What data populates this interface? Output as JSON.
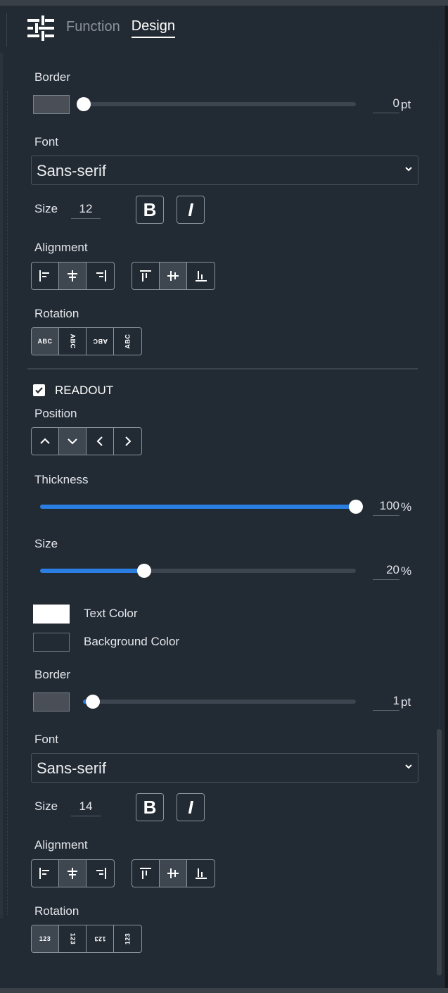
{
  "tabs": {
    "function": "Function",
    "design": "Design"
  },
  "border1": {
    "label": "Border",
    "value": 0,
    "unit": "pt",
    "slider_fraction": 0.0,
    "swatch_color": "#4a4f57"
  },
  "font1": {
    "label": "Font",
    "value": "Sans-serif",
    "size_label": "Size",
    "size_value": "12",
    "bold": "B",
    "italic": "I"
  },
  "align1": {
    "label": "Alignment"
  },
  "rotation1": {
    "label": "Rotation",
    "options": [
      "ABC",
      "ABC",
      "ABC",
      "ABC"
    ]
  },
  "readout": {
    "label": "READOUT",
    "checked": true
  },
  "position": {
    "label": "Position"
  },
  "thickness": {
    "label": "Thickness",
    "value": "100",
    "unit": "%",
    "slider_fraction": 1.0
  },
  "size_slider": {
    "label": "Size",
    "value": "20",
    "unit": "%",
    "slider_fraction": 0.33
  },
  "text_color": {
    "label": "Text Color",
    "color": "#ffffff"
  },
  "bg_color": {
    "label": "Background Color",
    "color": "#222a33"
  },
  "border2": {
    "label": "Border",
    "value": 1,
    "unit": "pt",
    "slider_fraction": 0.03,
    "swatch_color": "#4a4f57"
  },
  "font2": {
    "label": "Font",
    "value": "Sans-serif",
    "size_label": "Size",
    "size_value": "14",
    "bold": "B",
    "italic": "I"
  },
  "align2": {
    "label": "Alignment"
  },
  "rotation2": {
    "label": "Rotation",
    "options": [
      "123",
      "123",
      "123",
      "123"
    ]
  },
  "colors": {
    "accent": "#2a7de1",
    "panel": "#222a33"
  }
}
